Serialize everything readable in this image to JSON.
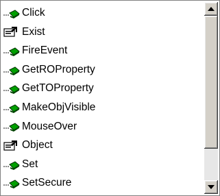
{
  "list": {
    "items": [
      {
        "label": "Click",
        "icon": "method-icon"
      },
      {
        "label": "Exist",
        "icon": "property-icon"
      },
      {
        "label": "FireEvent",
        "icon": "method-icon"
      },
      {
        "label": "GetROProperty",
        "icon": "method-icon"
      },
      {
        "label": "GetTOProperty",
        "icon": "method-icon"
      },
      {
        "label": "MakeObjVisible",
        "icon": "method-icon"
      },
      {
        "label": "MouseOver",
        "icon": "method-icon"
      },
      {
        "label": "Object",
        "icon": "property-icon"
      },
      {
        "label": "Set",
        "icon": "method-icon"
      },
      {
        "label": "SetSecure",
        "icon": "method-icon"
      }
    ]
  },
  "colors": {
    "method_icon_green": "#00a000",
    "selection": "#000080",
    "scrollbar_face": "#d4d0c8"
  }
}
